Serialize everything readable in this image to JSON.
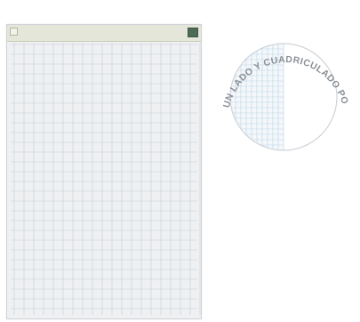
{
  "pad": {
    "header_text": "",
    "left_side": "lined",
    "badge_color": "#4e6b58",
    "grid_color": "#c8ced6",
    "paper_color": "#eef0f2"
  },
  "detail_circle": {
    "caption_top": "LISO POR UN LADO Y CUADRICULADO POR EL OTRO",
    "grid_color": "#b9d3e6",
    "plain_color": "#ffffff",
    "border_color": "#cfd3d8"
  }
}
